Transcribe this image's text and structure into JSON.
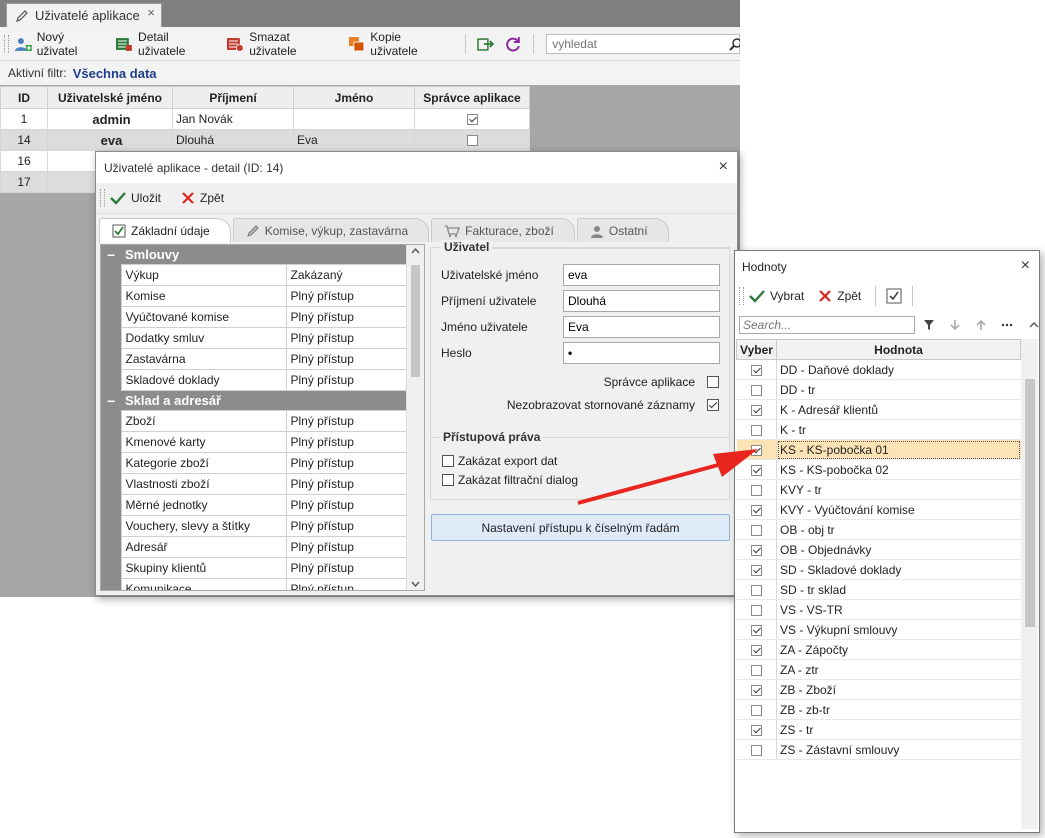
{
  "main": {
    "tab_title": "Uživatelé aplikace",
    "tab_close": "×",
    "toolbar": {
      "new_user": "Nový uživatel",
      "user_detail": "Detail uživatele",
      "delete_user": "Smazat uživatele",
      "copy_user": "Kopie uživatele",
      "search_placeholder": "vyhledat"
    },
    "filter": {
      "label": "Aktivní filtr:",
      "value": "Všechna data"
    },
    "grid": {
      "columns": [
        "ID",
        "Uživatelské jméno",
        "Příjmení",
        "Jméno",
        "Správce aplikace"
      ],
      "rows": [
        {
          "id": "1",
          "username": "admin",
          "surname": "Jan Novák",
          "name": "",
          "admin": true
        },
        {
          "id": "14",
          "username": "eva",
          "surname": "Dlouhá",
          "name": "Eva",
          "admin": false
        },
        {
          "id": "16"
        },
        {
          "id": "17"
        }
      ]
    }
  },
  "detail": {
    "title": "Uživatelé aplikace - detail  (ID: 14)",
    "close": "×",
    "save": "Uložit",
    "back": "Zpět",
    "tabs": [
      "Základní údaje",
      "Komise, výkup, zastavárna",
      "Fakturace, zboží",
      "Ostatní"
    ],
    "groups": [
      {
        "name": "Smlouvy",
        "items": [
          {
            "name": "Výkup",
            "value": "Zakázaný"
          },
          {
            "name": "Komise",
            "value": "Plný přístup"
          },
          {
            "name": "Vyúčtované komise",
            "value": "Plný přístup"
          },
          {
            "name": "Dodatky smluv",
            "value": "Plný přístup"
          },
          {
            "name": "Zastavárna",
            "value": "Plný přístup"
          },
          {
            "name": "Skladové doklady",
            "value": "Plný přístup"
          }
        ]
      },
      {
        "name": "Sklad a adresář",
        "items": [
          {
            "name": "Zboží",
            "value": "Plný přístup"
          },
          {
            "name": "Kmenové karty",
            "value": "Plný přístup"
          },
          {
            "name": "Kategorie zboží",
            "value": "Plný přístup"
          },
          {
            "name": "Vlastnosti zboží",
            "value": "Plný přístup"
          },
          {
            "name": "Měrné jednotky",
            "value": "Plný přístup"
          },
          {
            "name": "Vouchery, slevy a štítky",
            "value": "Plný přístup"
          },
          {
            "name": "Adresář",
            "value": "Plný přístup"
          },
          {
            "name": "Skupiny klientů",
            "value": "Plný přístup"
          },
          {
            "name": "Komunikace",
            "value": "Plný přístup"
          }
        ]
      }
    ],
    "user_section": {
      "title": "Uživatel",
      "username_label": "Uživatelské jméno",
      "username": "eva",
      "surname_label": "Příjmení uživatele",
      "surname": "Dlouhá",
      "name_label": "Jméno uživatele",
      "name": "Eva",
      "password_label": "Heslo",
      "password": "•",
      "admin_label": "Správce aplikace",
      "admin": false,
      "hide_cancelled_label": "Nezobrazovat stornované záznamy",
      "hide_cancelled": true
    },
    "access_section": {
      "title": "Přístupová práva",
      "export_label": "Zakázat export dat",
      "filter_dialog_label": "Zakázat filtrační dialog"
    },
    "series_button": "Nastavení přístupu k číselným řadám"
  },
  "values": {
    "title": "Hodnoty",
    "close": "×",
    "select": "Vybrat",
    "back": "Zpět",
    "search_placeholder": "Search...",
    "col_select": "Vyber",
    "col_value": "Hodnota",
    "rows": [
      {
        "value": "DD - Daňové doklady",
        "checked": true
      },
      {
        "value": "DD - tr",
        "checked": false
      },
      {
        "value": "K - Adresář klientů",
        "checked": true
      },
      {
        "value": "K - tr",
        "checked": false
      },
      {
        "value": "KS - KS-pobočka 01",
        "checked": true,
        "highlight": true
      },
      {
        "value": "KS - KS-pobočka 02",
        "checked": true
      },
      {
        "value": "KVY - tr",
        "checked": false
      },
      {
        "value": "KVY - Vyúčtování komise",
        "checked": true
      },
      {
        "value": "OB - obj tr",
        "checked": false
      },
      {
        "value": "OB - Objednávky",
        "checked": true
      },
      {
        "value": "SD - Skladové doklady",
        "checked": true
      },
      {
        "value": "SD - tr sklad",
        "checked": false
      },
      {
        "value": "VS - VS-TR",
        "checked": false
      },
      {
        "value": "VS - Výkupní smlouvy",
        "checked": true
      },
      {
        "value": "ZA - Zápočty",
        "checked": true
      },
      {
        "value": "ZA - ztr",
        "checked": false
      },
      {
        "value": "ZB - Zboží",
        "checked": true
      },
      {
        "value": "ZB - zb-tr",
        "checked": false
      },
      {
        "value": "ZS - tr",
        "checked": true
      },
      {
        "value": "ZS - Zástavní smlouvy",
        "checked": false
      }
    ]
  },
  "colors": {
    "arrow": "#e8261f",
    "filter_value": "#1f3d8a",
    "highlight_row": "#fbe3b5"
  }
}
